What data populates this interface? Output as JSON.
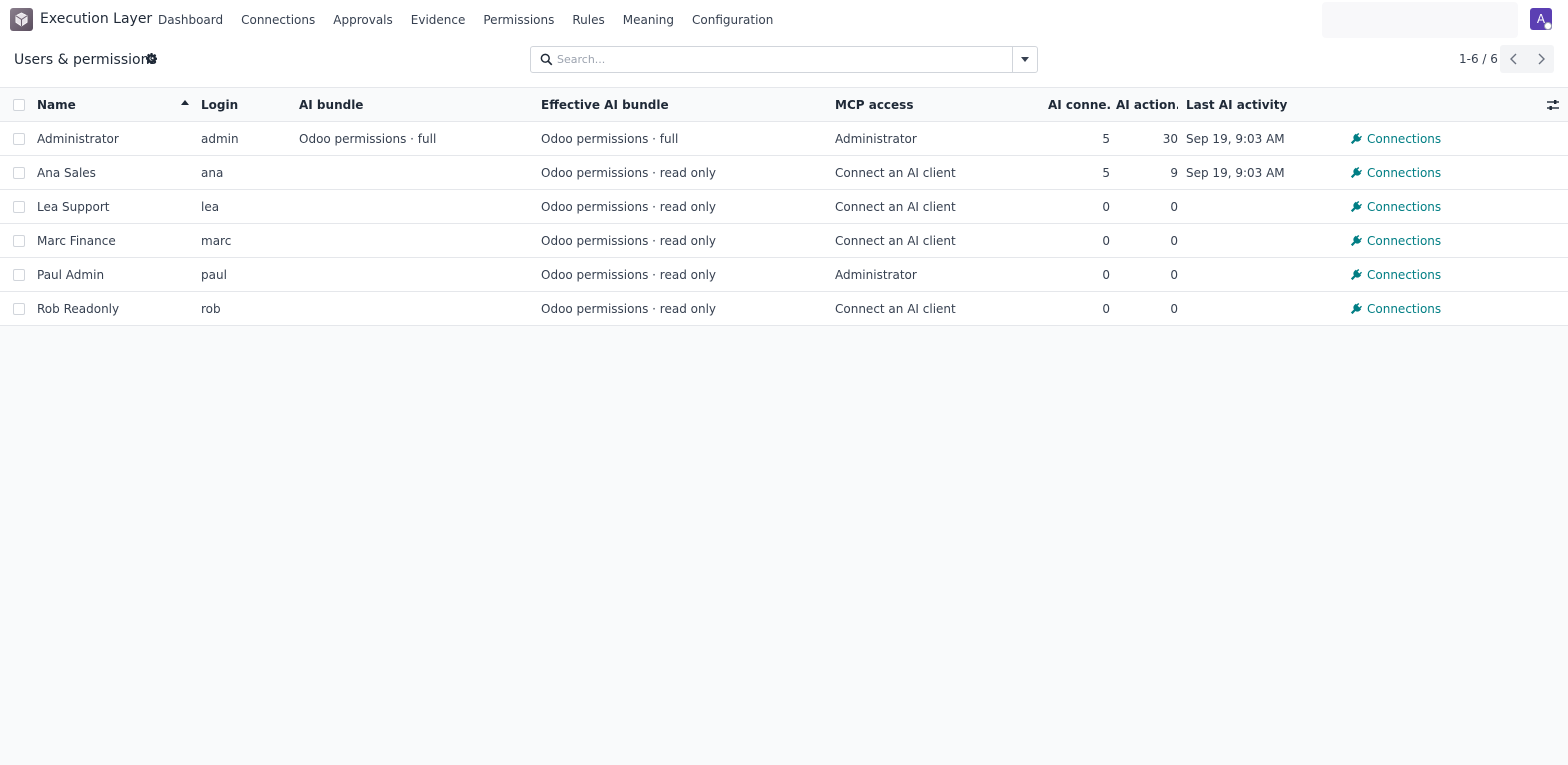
{
  "app": {
    "name": "Execution Layer",
    "menu": [
      "Dashboard",
      "Connections",
      "Approvals",
      "Evidence",
      "Permissions",
      "Rules",
      "Meaning",
      "Configuration"
    ],
    "avatar_letter": "A"
  },
  "control_panel": {
    "title": "Users & permissions",
    "search_placeholder": "Search...",
    "pager": "1-6 / 6"
  },
  "colors": {
    "accent": "#017e84",
    "avatar": "#5b3fb3"
  },
  "table": {
    "columns": {
      "name": "Name",
      "login": "Login",
      "ai_bundle": "AI bundle",
      "effective_ai_bundle": "Effective AI bundle",
      "mcp_access": "MCP access",
      "ai_connections": "AI conne...",
      "ai_actions": "AI action...",
      "last_ai_activity": "Last AI activity"
    },
    "rows": [
      {
        "name": "Administrator",
        "login": "admin",
        "ai_bundle": "Odoo permissions · full",
        "effective": "Odoo permissions · full",
        "mcp": "Administrator",
        "conns": "5",
        "actions": "30",
        "last": "Sep 19, 9:03 AM",
        "link": "Connections"
      },
      {
        "name": "Ana Sales",
        "login": "ana",
        "ai_bundle": "",
        "effective": "Odoo permissions · read only",
        "mcp": "Connect an AI client",
        "conns": "5",
        "actions": "9",
        "last": "Sep 19, 9:03 AM",
        "link": "Connections"
      },
      {
        "name": "Lea Support",
        "login": "lea",
        "ai_bundle": "",
        "effective": "Odoo permissions · read only",
        "mcp": "Connect an AI client",
        "conns": "0",
        "actions": "0",
        "last": "",
        "link": "Connections"
      },
      {
        "name": "Marc Finance",
        "login": "marc",
        "ai_bundle": "",
        "effective": "Odoo permissions · read only",
        "mcp": "Connect an AI client",
        "conns": "0",
        "actions": "0",
        "last": "",
        "link": "Connections"
      },
      {
        "name": "Paul Admin",
        "login": "paul",
        "ai_bundle": "",
        "effective": "Odoo permissions · read only",
        "mcp": "Administrator",
        "conns": "0",
        "actions": "0",
        "last": "",
        "link": "Connections"
      },
      {
        "name": "Rob Readonly",
        "login": "rob",
        "ai_bundle": "",
        "effective": "Odoo permissions · read only",
        "mcp": "Connect an AI client",
        "conns": "0",
        "actions": "0",
        "last": "",
        "link": "Connections"
      }
    ]
  }
}
